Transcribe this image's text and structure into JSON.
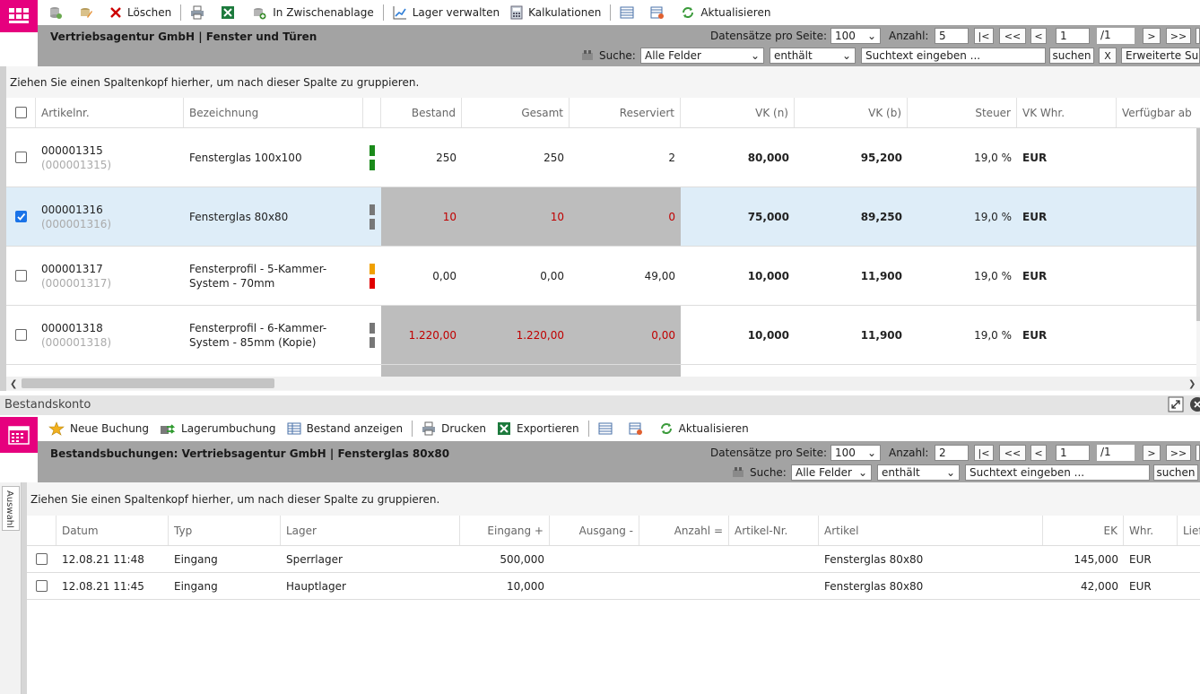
{
  "top_toolbar": {
    "delete_label": "Löschen",
    "clipboard_label": "In Zwischenablage",
    "stock_label": "Lager verwalten",
    "calc_label": "Kalkulationen",
    "refresh_label": "Aktualisieren"
  },
  "top_header": {
    "title": "Vertriebsagentur GmbH | Fenster und Türen",
    "per_page_label": "Datensätze pro Seite:",
    "per_page_value": "100",
    "count_label": "Anzahl:",
    "count_value": "5",
    "first_label": "|<",
    "prev_prev_label": "<<",
    "prev_label": "<",
    "page_value": "1",
    "total_pages": "/1",
    "next_label": ">",
    "next_next_label": ">>",
    "search_label": "Suche:",
    "field_value": "Alle Felder",
    "op_value": "enthält",
    "search_placeholder": "Suchtext eingeben ...",
    "search_button": "suchen",
    "clear_button": "X",
    "advanced_button": "Erweiterte Suc"
  },
  "top_grid": {
    "group_hint": "Ziehen Sie einen Spaltenkopf hierher, um nach dieser Spalte zu gruppieren.",
    "columns": [
      "Artikelnr.",
      "Bezeichnung",
      "Bestand",
      "Gesamt",
      "Reserviert",
      "VK (n)",
      "VK (b)",
      "Steuer",
      "VK Whr.",
      "Verfügbar ab"
    ],
    "rows": [
      {
        "nr": "000001315",
        "nr_sub": "(000001315)",
        "name1": "Fensterglas 100x100",
        "name2": "",
        "bestand": "250",
        "gesamt": "250",
        "reserviert": "2",
        "vkn": "80,000",
        "vkb": "95,200",
        "steuer": "19,0 %",
        "whr": "EUR",
        "stock_top": "#1a8a1a",
        "stock_bottom": "#1a8a1a",
        "selected": false,
        "highlight": false
      },
      {
        "nr": "000001316",
        "nr_sub": "(000001316)",
        "name1": "Fensterglas 80x80",
        "name2": "",
        "bestand": "10",
        "gesamt": "10",
        "reserviert": "0",
        "vkn": "75,000",
        "vkb": "89,250",
        "steuer": "19,0 %",
        "whr": "EUR",
        "stock_top": "#777777",
        "stock_bottom": "#777777",
        "selected": true,
        "highlight": true
      },
      {
        "nr": "000001317",
        "nr_sub": "(000001317)",
        "name1": "Fensterprofil - 5-Kammer-",
        "name2": "System - 70mm",
        "bestand": "0,00",
        "gesamt": "0,00",
        "reserviert": "49,00",
        "vkn": "10,000",
        "vkb": "11,900",
        "steuer": "19,0 %",
        "whr": "EUR",
        "stock_top": "#f0a000",
        "stock_bottom": "#e00000",
        "selected": false,
        "highlight": false
      },
      {
        "nr": "000001318",
        "nr_sub": "(000001318)",
        "name1": "Fensterprofil - 6-Kammer-",
        "name2": "System - 85mm (Kopie)",
        "bestand": "1.220,00",
        "gesamt": "1.220,00",
        "reserviert": "0,00",
        "vkn": "10,000",
        "vkb": "11,900",
        "steuer": "19,0 %",
        "whr": "EUR",
        "stock_top": "#777777",
        "stock_bottom": "#777777",
        "selected": false,
        "highlight": true
      }
    ]
  },
  "bottom_panel": {
    "title": "Bestandskonto",
    "side_tab": "Auswahl"
  },
  "bottom_toolbar": {
    "new_booking": "Neue Buchung",
    "transfer": "Lagerumbuchung",
    "show_stock": "Bestand anzeigen",
    "print": "Drucken",
    "export": "Exportieren",
    "refresh": "Aktualisieren"
  },
  "bottom_header": {
    "title": "Bestandsbuchungen: Vertriebsagentur GmbH | Fensterglas 80x80",
    "per_page_label": "Datensätze pro Seite:",
    "per_page_value": "100",
    "count_label": "Anzahl:",
    "count_value": "2",
    "first_label": "|<",
    "prev_prev_label": "<<",
    "prev_label": "<",
    "page_value": "1",
    "total_pages": "/1",
    "next_label": ">",
    "next_next_label": ">>",
    "search_label": "Suche:",
    "field_value": "Alle Felder",
    "op_value": "enthält",
    "search_placeholder": "Suchtext eingeben ...",
    "search_button": "suchen"
  },
  "bottom_grid": {
    "group_hint": "Ziehen Sie einen Spaltenkopf hierher, um nach dieser Spalte zu gruppieren.",
    "columns": [
      "Datum",
      "Typ",
      "Lager",
      "Eingang +",
      "Ausgang -",
      "Anzahl =",
      "Artikel-Nr.",
      "Artikel",
      "EK",
      "Whr.",
      "Lief"
    ],
    "rows": [
      {
        "datum": "12.08.21 11:48",
        "typ": "Eingang",
        "lager": "Sperrlager",
        "eingang": "500,000",
        "artikel": "Fensterglas 80x80",
        "ek": "145,000",
        "whr": "EUR"
      },
      {
        "datum": "12.08.21 11:45",
        "typ": "Eingang",
        "lager": "Hauptlager",
        "eingang": "10,000",
        "artikel": "Fensterglas 80x80",
        "ek": "42,000",
        "whr": "EUR"
      }
    ]
  }
}
